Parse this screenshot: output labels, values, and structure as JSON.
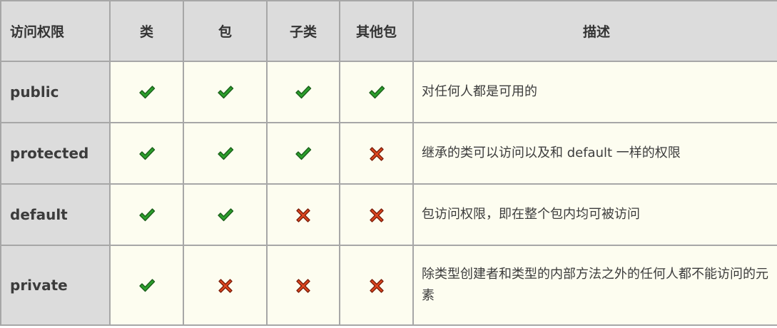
{
  "headers": {
    "access": "访问权限",
    "class": "类",
    "package": "包",
    "subclass": "子类",
    "other_package": "其他包",
    "description": "描述"
  },
  "rows": [
    {
      "name": "public",
      "access": [
        "yes",
        "yes",
        "yes",
        "yes"
      ],
      "description": "对任何人都是可用的"
    },
    {
      "name": "protected",
      "access": [
        "yes",
        "yes",
        "yes",
        "no"
      ],
      "description": "继承的类可以访问以及和 default 一样的权限"
    },
    {
      "name": "default",
      "access": [
        "yes",
        "yes",
        "no",
        "no"
      ],
      "description": "包访问权限，即在整个包内均可被访问"
    },
    {
      "name": "private",
      "access": [
        "yes",
        "no",
        "no",
        "no"
      ],
      "description": "除类型创建者和类型的内部方法之外的任何人都不能访问的元素"
    }
  ],
  "colors": {
    "check": "#2ca02c",
    "cross": "#e0461f"
  },
  "icons": {
    "yes": "check-icon",
    "no": "cross-icon"
  }
}
